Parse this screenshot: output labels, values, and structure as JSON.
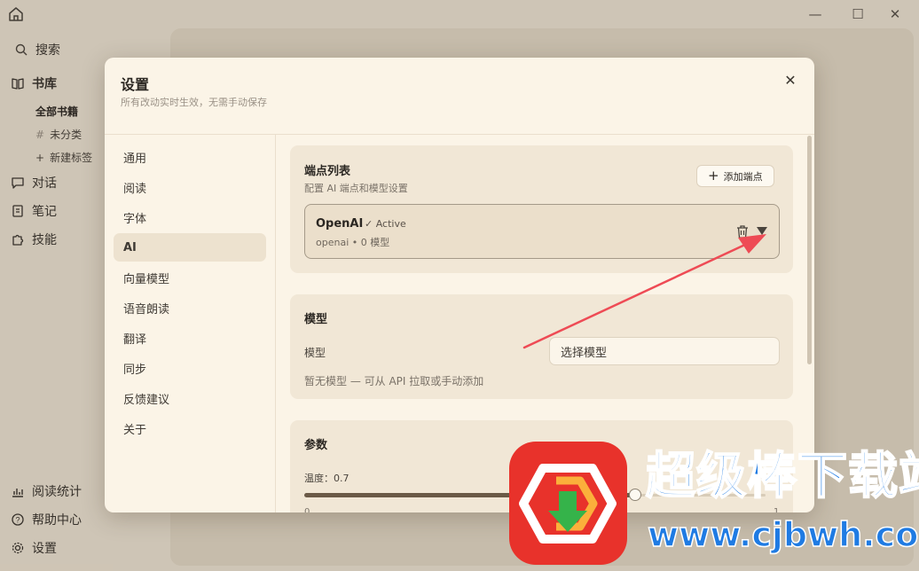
{
  "window": {
    "controls": {
      "minimize_icon": "minimize-icon",
      "maximize_icon": "maximize-icon",
      "close_icon": "close-icon"
    }
  },
  "sidebar": {
    "search": "搜索",
    "library": "书库",
    "library_items": [
      "全部书籍",
      "未分类",
      "新建标签"
    ],
    "chat": "对话",
    "notes": "笔记",
    "skills": "技能",
    "stats": "阅读统计",
    "help": "帮助中心",
    "settings": "设置"
  },
  "dialog": {
    "title": "设置",
    "subtitle": "所有改动实时生效，无需手动保存",
    "nav": [
      "通用",
      "阅读",
      "字体",
      "AI",
      "向量模型",
      "语音朗读",
      "翻译",
      "同步",
      "反馈建议",
      "关于"
    ],
    "active_nav": "AI"
  },
  "endpoints": {
    "title": "端点列表",
    "desc": "配置 AI 端点和模型设置",
    "add_button": "添加端点",
    "items": [
      {
        "name": "OpenAI",
        "status": "✓ Active",
        "meta": "openai • 0 模型"
      }
    ]
  },
  "model": {
    "title": "模型",
    "label": "模型",
    "placeholder": "选择模型",
    "hint": "暂无模型 — 可从 API 拉取或手动添加"
  },
  "params": {
    "title": "参数",
    "temperature_label": "温度：0.7",
    "temperature": 0.7,
    "tick_min": "0",
    "tick_max": "1"
  },
  "watermark": {
    "text": "超级棒下载站",
    "url": "www.cjbwh.com"
  },
  "colors": {
    "accent": "#6b5a47",
    "annotation_arrow": "#ee4b55",
    "watermark_blue": "#1f7be3",
    "watermark_red": "#e8322b"
  }
}
